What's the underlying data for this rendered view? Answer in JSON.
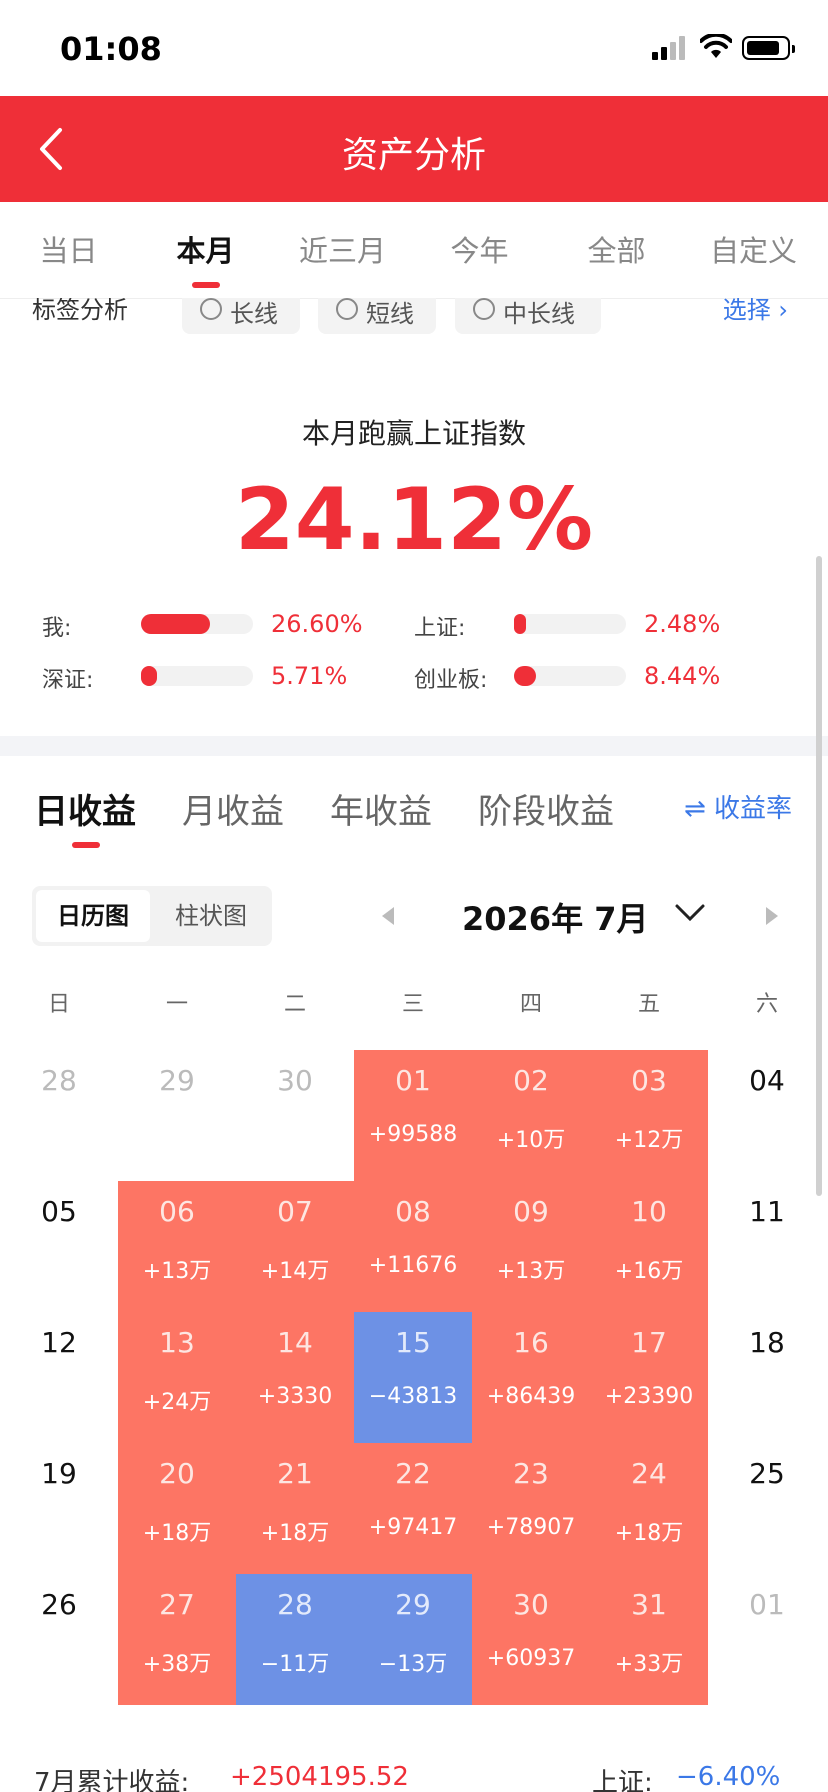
{
  "status_bar": {
    "time": "01:08"
  },
  "header": {
    "title": "资产分析"
  },
  "period_tabs": [
    {
      "label": "当日"
    },
    {
      "label": "本月"
    },
    {
      "label": "近三月"
    },
    {
      "label": "今年"
    },
    {
      "label": "全部"
    },
    {
      "label": "自定义"
    }
  ],
  "active_period_index": 1,
  "tag_analysis": {
    "label": "标签分析",
    "chips": [
      {
        "label": "长线"
      },
      {
        "label": "短线"
      },
      {
        "label": "中长线"
      }
    ],
    "select_label": "选择 ›"
  },
  "summary": {
    "subtitle": "本月跑赢上证指数",
    "big_value": "24.12%",
    "comparisons": [
      {
        "label": "我:",
        "value": "26.60%",
        "fill": 0.62
      },
      {
        "label": "上证:",
        "value": "2.48%",
        "fill": 0.06
      },
      {
        "label": "深证:",
        "value": "5.71%",
        "fill": 0.14
      },
      {
        "label": "创业板:",
        "value": "8.44%",
        "fill": 0.2
      }
    ]
  },
  "earnings_tabs": [
    {
      "label": "日收益"
    },
    {
      "label": "月收益"
    },
    {
      "label": "年收益"
    },
    {
      "label": "阶段收益"
    }
  ],
  "rate_button": "⇌ 收益率",
  "view_toggle": [
    {
      "label": "日历图"
    },
    {
      "label": "柱状图"
    }
  ],
  "month_label": "2026年 7月",
  "weekdays": [
    "日",
    "一",
    "二",
    "三",
    "四",
    "五",
    "六"
  ],
  "calendar": [
    [
      {
        "d": "28",
        "s": "dim"
      },
      {
        "d": "29",
        "s": "dim"
      },
      {
        "d": "30",
        "s": "dim"
      },
      {
        "d": "01",
        "v": "+99588",
        "s": "gain"
      },
      {
        "d": "02",
        "v": "+10万",
        "s": "gain"
      },
      {
        "d": "03",
        "v": "+12万",
        "s": "gain"
      },
      {
        "d": "04",
        "s": "plain"
      }
    ],
    [
      {
        "d": "05",
        "s": "plain"
      },
      {
        "d": "06",
        "v": "+13万",
        "s": "gain"
      },
      {
        "d": "07",
        "v": "+14万",
        "s": "gain"
      },
      {
        "d": "08",
        "v": "+11676",
        "s": "gain"
      },
      {
        "d": "09",
        "v": "+13万",
        "s": "gain"
      },
      {
        "d": "10",
        "v": "+16万",
        "s": "gain"
      },
      {
        "d": "11",
        "s": "plain"
      }
    ],
    [
      {
        "d": "12",
        "s": "plain"
      },
      {
        "d": "13",
        "v": "+24万",
        "s": "gain"
      },
      {
        "d": "14",
        "v": "+3330",
        "s": "gain"
      },
      {
        "d": "15",
        "v": "−43813",
        "s": "loss"
      },
      {
        "d": "16",
        "v": "+86439",
        "s": "gain"
      },
      {
        "d": "17",
        "v": "+23390",
        "s": "gain"
      },
      {
        "d": "18",
        "s": "plain"
      }
    ],
    [
      {
        "d": "19",
        "s": "plain"
      },
      {
        "d": "20",
        "v": "+18万",
        "s": "gain"
      },
      {
        "d": "21",
        "v": "+18万",
        "s": "gain"
      },
      {
        "d": "22",
        "v": "+97417",
        "s": "gain"
      },
      {
        "d": "23",
        "v": "+78907",
        "s": "gain"
      },
      {
        "d": "24",
        "v": "+18万",
        "s": "gain"
      },
      {
        "d": "25",
        "s": "plain"
      }
    ],
    [
      {
        "d": "26",
        "s": "plain"
      },
      {
        "d": "27",
        "v": "+38万",
        "s": "gain"
      },
      {
        "d": "28",
        "v": "−11万",
        "s": "loss"
      },
      {
        "d": "29",
        "v": "−13万",
        "s": "loss"
      },
      {
        "d": "30",
        "v": "+60937",
        "s": "gain"
      },
      {
        "d": "31",
        "v": "+33万",
        "s": "gain"
      },
      {
        "d": "01",
        "s": "dim"
      }
    ]
  ],
  "footer": {
    "cum_label": "7月累计收益:",
    "cum_value": "+2504195.52",
    "index_label": "上证:",
    "index_value": "−6.40%"
  },
  "colors": {
    "brand_red": "#ef2f38",
    "gain": "#fd7564",
    "loss": "#6d91e5",
    "link": "#3b78e7"
  }
}
